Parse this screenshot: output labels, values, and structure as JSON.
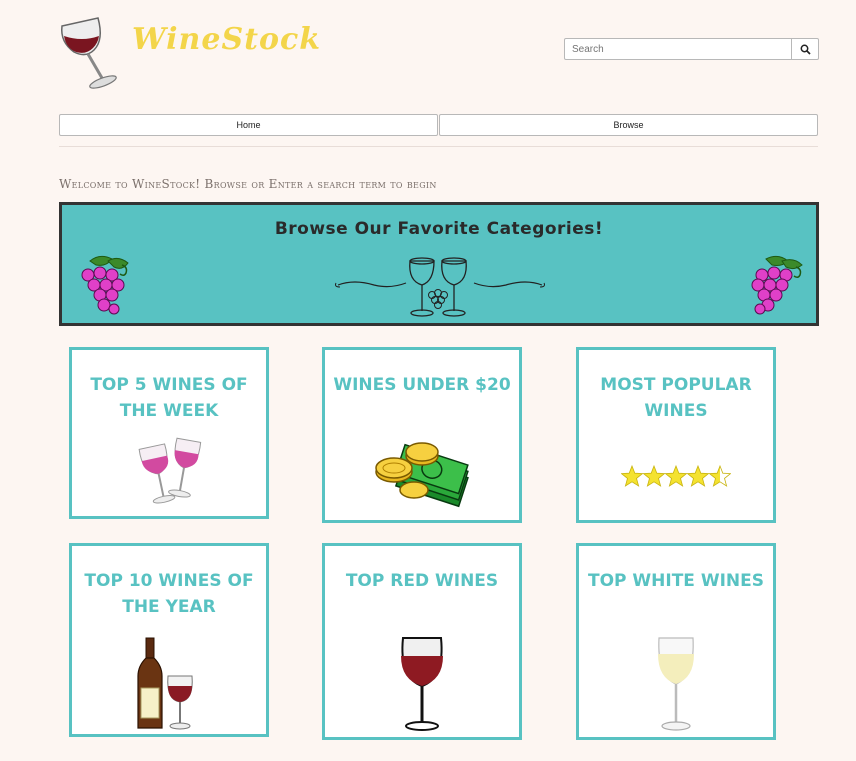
{
  "brand": {
    "name": "WineStock",
    "logo_icon": "wine-glass-icon"
  },
  "search": {
    "placeholder": "Search",
    "button_icon": "search-icon"
  },
  "nav": {
    "items": [
      {
        "label": "Home"
      },
      {
        "label": "Browse"
      }
    ]
  },
  "welcome_text": "Welcome to WineStock! Browse or Enter a search term to begin",
  "banner": {
    "title": "Browse Our Favorite Categories!"
  },
  "cards": [
    {
      "title": "Top 5 Wines of the Week",
      "icon": "toasting-glasses-icon"
    },
    {
      "title": "Wines Under $20",
      "icon": "coins-money-icon"
    },
    {
      "title": "Most Popular Wines",
      "icon": "star-rating-icon",
      "rating": 4.5,
      "rating_max": 5
    },
    {
      "title": "Top 10 Wines of the Year",
      "icon": "bottle-glass-icon"
    },
    {
      "title": "Top Red Wines",
      "icon": "red-wine-glass-icon"
    },
    {
      "title": "Top White Wines",
      "icon": "white-wine-glass-icon"
    }
  ],
  "colors": {
    "accent": "#58c2c2",
    "brand": "#f3d54a",
    "background": "#fdf6f2",
    "banner_border": "#333333"
  }
}
